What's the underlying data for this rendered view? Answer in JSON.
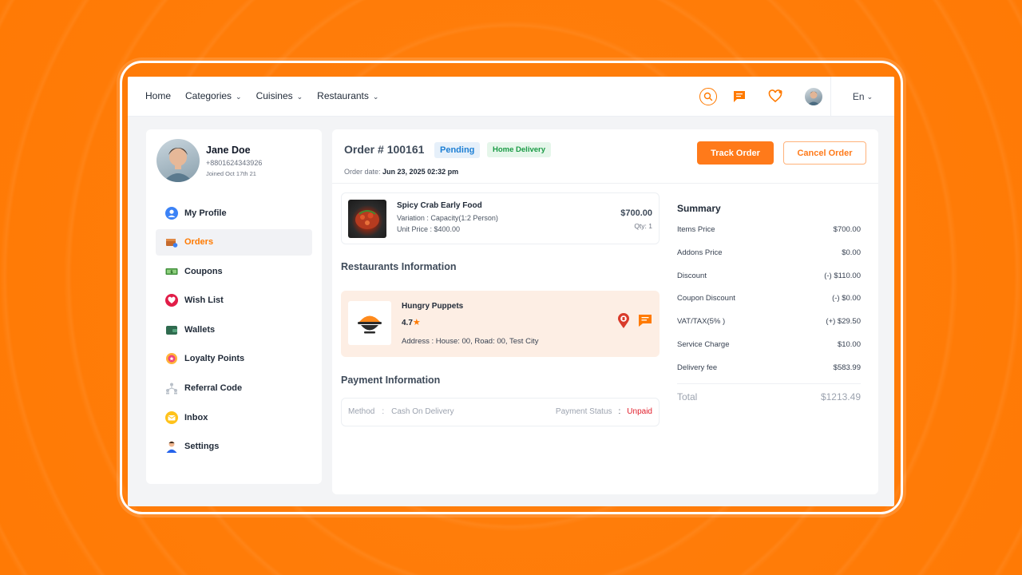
{
  "header": {
    "nav": [
      {
        "label": "Home",
        "has_chevron": false
      },
      {
        "label": "Categories",
        "has_chevron": true
      },
      {
        "label": "Cuisines",
        "has_chevron": true
      },
      {
        "label": "Restaurants",
        "has_chevron": true
      }
    ],
    "language": "En",
    "icons": [
      "search-icon",
      "chat-icon",
      "heart-icon",
      "avatar"
    ]
  },
  "profile": {
    "name": "Jane Doe",
    "phone": "+8801624343926",
    "joined": "Joined Oct 17th 21"
  },
  "menu": [
    {
      "label": "My Profile",
      "icon": "user-icon",
      "active": false
    },
    {
      "label": "Orders",
      "icon": "orders-icon",
      "active": true
    },
    {
      "label": "Coupons",
      "icon": "coupon-icon",
      "active": false
    },
    {
      "label": "Wish List",
      "icon": "heart-icon",
      "active": false
    },
    {
      "label": "Wallets",
      "icon": "wallet-icon",
      "active": false
    },
    {
      "label": "Loyalty Points",
      "icon": "loyalty-icon",
      "active": false
    },
    {
      "label": "Referral Code",
      "icon": "referral-icon",
      "active": false
    },
    {
      "label": "Inbox",
      "icon": "inbox-icon",
      "active": false
    },
    {
      "label": "Settings",
      "icon": "settings-icon",
      "active": false
    }
  ],
  "order": {
    "title": "Order # 100161",
    "status": "Pending",
    "type": "Home Delivery",
    "date_label": "Order date:",
    "date_value": "Jun 23, 2025 02:32 pm",
    "track_label": "Track Order",
    "cancel_label": "Cancel Order"
  },
  "item": {
    "name": "Spicy Crab Early Food",
    "variation": "Variation : Capacity(1:2 Person)",
    "unit_price": "Unit Price : $400.00",
    "price": "$700.00",
    "qty": "Qty: 1"
  },
  "restaurant": {
    "section_title": "Restaurants Information",
    "name": "Hungry Puppets",
    "rating": "4.7",
    "address": "Address : House: 00, Road: 00, Test City"
  },
  "payment": {
    "section_title": "Payment Information",
    "method_label": "Method",
    "method_value": "Cash On Delivery",
    "status_label": "Payment Status",
    "status_value": "Unpaid",
    "colon": ":"
  },
  "summary": {
    "title": "Summary",
    "rows": [
      {
        "label": "Items Price",
        "value": "$700.00"
      },
      {
        "label": "Addons Price",
        "value": "$0.00"
      },
      {
        "label": "Discount",
        "value": "(-) $110.00"
      },
      {
        "label": "Coupon Discount",
        "value": "(-) $0.00"
      },
      {
        "label": "VAT/TAX(5% )",
        "value": "(+) $29.50"
      },
      {
        "label": "Service Charge",
        "value": "$10.00"
      },
      {
        "label": "Delivery fee",
        "value": "$583.99"
      }
    ],
    "total_label": "Total",
    "total_value": "$1213.49"
  },
  "colors": {
    "accent": "#ff7a00",
    "background": "#ff7d0a",
    "pending": "#1d7fd4",
    "delivery": "#1a9b45",
    "unpaid": "#e11d2a"
  }
}
